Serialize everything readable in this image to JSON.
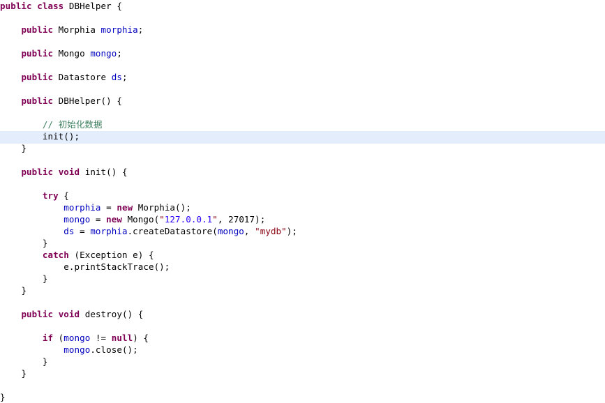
{
  "editor": {
    "language": "java",
    "class_name": "DBHelper",
    "background_color": "#ffffff",
    "current_line_highlight_color": "#e4edfb",
    "current_line_index": 11,
    "palette": {
      "keyword": "#7f0055",
      "field": "#0000c0",
      "comment": "#3f7f5f",
      "string": "#8b0011",
      "string_alt": "#2a00ff",
      "plain": "#000000"
    }
  },
  "code": {
    "lines": [
      {
        "index": 0,
        "indent": 0,
        "tokens": [
          {
            "t": "public",
            "c": "kw"
          },
          {
            "t": " ",
            "c": "pln"
          },
          {
            "t": "class",
            "c": "kw"
          },
          {
            "t": " DBHelper {",
            "c": "pln"
          }
        ]
      },
      {
        "index": 1,
        "indent": 0,
        "tokens": []
      },
      {
        "index": 2,
        "indent": 1,
        "tokens": [
          {
            "t": "public",
            "c": "kw"
          },
          {
            "t": " Morphia ",
            "c": "pln"
          },
          {
            "t": "morphia",
            "c": "fld"
          },
          {
            "t": ";",
            "c": "pln"
          }
        ]
      },
      {
        "index": 3,
        "indent": 0,
        "tokens": []
      },
      {
        "index": 4,
        "indent": 1,
        "tokens": [
          {
            "t": "public",
            "c": "kw"
          },
          {
            "t": " Mongo ",
            "c": "pln"
          },
          {
            "t": "mongo",
            "c": "fld"
          },
          {
            "t": ";",
            "c": "pln"
          }
        ]
      },
      {
        "index": 5,
        "indent": 0,
        "tokens": []
      },
      {
        "index": 6,
        "indent": 1,
        "tokens": [
          {
            "t": "public",
            "c": "kw"
          },
          {
            "t": " Datastore ",
            "c": "pln"
          },
          {
            "t": "ds",
            "c": "fld"
          },
          {
            "t": ";",
            "c": "pln"
          }
        ]
      },
      {
        "index": 7,
        "indent": 0,
        "tokens": []
      },
      {
        "index": 8,
        "indent": 1,
        "tokens": [
          {
            "t": "public",
            "c": "kw"
          },
          {
            "t": " DBHelper() {",
            "c": "pln"
          }
        ]
      },
      {
        "index": 9,
        "indent": 0,
        "tokens": []
      },
      {
        "index": 10,
        "indent": 2,
        "tokens": [
          {
            "t": "// ",
            "c": "cmt"
          },
          {
            "t": "初始化数据",
            "c": "cmt cjk"
          }
        ]
      },
      {
        "index": 11,
        "indent": 2,
        "tokens": [
          {
            "t": "init();",
            "c": "pln"
          }
        ]
      },
      {
        "index": 12,
        "indent": 1,
        "tokens": [
          {
            "t": "}",
            "c": "pln"
          }
        ]
      },
      {
        "index": 13,
        "indent": 0,
        "tokens": []
      },
      {
        "index": 14,
        "indent": 1,
        "tokens": [
          {
            "t": "public",
            "c": "kw"
          },
          {
            "t": " ",
            "c": "pln"
          },
          {
            "t": "void",
            "c": "kw"
          },
          {
            "t": " init() {",
            "c": "pln"
          }
        ]
      },
      {
        "index": 15,
        "indent": 0,
        "tokens": []
      },
      {
        "index": 16,
        "indent": 2,
        "tokens": [
          {
            "t": "try",
            "c": "kw"
          },
          {
            "t": " {",
            "c": "pln"
          }
        ]
      },
      {
        "index": 17,
        "indent": 3,
        "tokens": [
          {
            "t": "morphia",
            "c": "fld"
          },
          {
            "t": " = ",
            "c": "pln"
          },
          {
            "t": "new",
            "c": "kw"
          },
          {
            "t": " Morphia();",
            "c": "pln"
          }
        ]
      },
      {
        "index": 18,
        "indent": 3,
        "tokens": [
          {
            "t": "mongo",
            "c": "fld"
          },
          {
            "t": " = ",
            "c": "pln"
          },
          {
            "t": "new",
            "c": "kw"
          },
          {
            "t": " Mongo(",
            "c": "pln"
          },
          {
            "t": "\"",
            "c": "str"
          },
          {
            "t": "127.0.0.1",
            "c": "strb"
          },
          {
            "t": "\"",
            "c": "str"
          },
          {
            "t": ", 27017);",
            "c": "pln"
          }
        ]
      },
      {
        "index": 19,
        "indent": 3,
        "tokens": [
          {
            "t": "ds",
            "c": "fld"
          },
          {
            "t": " = ",
            "c": "pln"
          },
          {
            "t": "morphia",
            "c": "fld"
          },
          {
            "t": ".createDatastore(",
            "c": "pln"
          },
          {
            "t": "mongo",
            "c": "fld"
          },
          {
            "t": ", ",
            "c": "pln"
          },
          {
            "t": "\"mydb\"",
            "c": "str"
          },
          {
            "t": ");",
            "c": "pln"
          }
        ]
      },
      {
        "index": 20,
        "indent": 2,
        "tokens": [
          {
            "t": "}",
            "c": "pln"
          }
        ]
      },
      {
        "index": 21,
        "indent": 2,
        "tokens": [
          {
            "t": "catch",
            "c": "kw"
          },
          {
            "t": " (Exception e) {",
            "c": "pln"
          }
        ]
      },
      {
        "index": 22,
        "indent": 3,
        "tokens": [
          {
            "t": "e.printStackTrace();",
            "c": "pln"
          }
        ]
      },
      {
        "index": 23,
        "indent": 2,
        "tokens": [
          {
            "t": "}",
            "c": "pln"
          }
        ]
      },
      {
        "index": 24,
        "indent": 1,
        "tokens": [
          {
            "t": "}",
            "c": "pln"
          }
        ]
      },
      {
        "index": 25,
        "indent": 0,
        "tokens": []
      },
      {
        "index": 26,
        "indent": 1,
        "tokens": [
          {
            "t": "public",
            "c": "kw"
          },
          {
            "t": " ",
            "c": "pln"
          },
          {
            "t": "void",
            "c": "kw"
          },
          {
            "t": " destroy() {",
            "c": "pln"
          }
        ]
      },
      {
        "index": 27,
        "indent": 0,
        "tokens": []
      },
      {
        "index": 28,
        "indent": 2,
        "tokens": [
          {
            "t": "if",
            "c": "kw"
          },
          {
            "t": " (",
            "c": "pln"
          },
          {
            "t": "mongo",
            "c": "fld"
          },
          {
            "t": " != ",
            "c": "pln"
          },
          {
            "t": "null",
            "c": "kw"
          },
          {
            "t": ") {",
            "c": "pln"
          }
        ]
      },
      {
        "index": 29,
        "indent": 3,
        "tokens": [
          {
            "t": "mongo",
            "c": "fld"
          },
          {
            "t": ".close();",
            "c": "pln"
          }
        ]
      },
      {
        "index": 30,
        "indent": 2,
        "tokens": [
          {
            "t": "}",
            "c": "pln"
          }
        ]
      },
      {
        "index": 31,
        "indent": 1,
        "tokens": [
          {
            "t": "}",
            "c": "pln"
          }
        ]
      },
      {
        "index": 32,
        "indent": 0,
        "tokens": []
      },
      {
        "index": 33,
        "indent": 0,
        "tokens": [
          {
            "t": "}",
            "c": "pln"
          }
        ]
      }
    ]
  }
}
